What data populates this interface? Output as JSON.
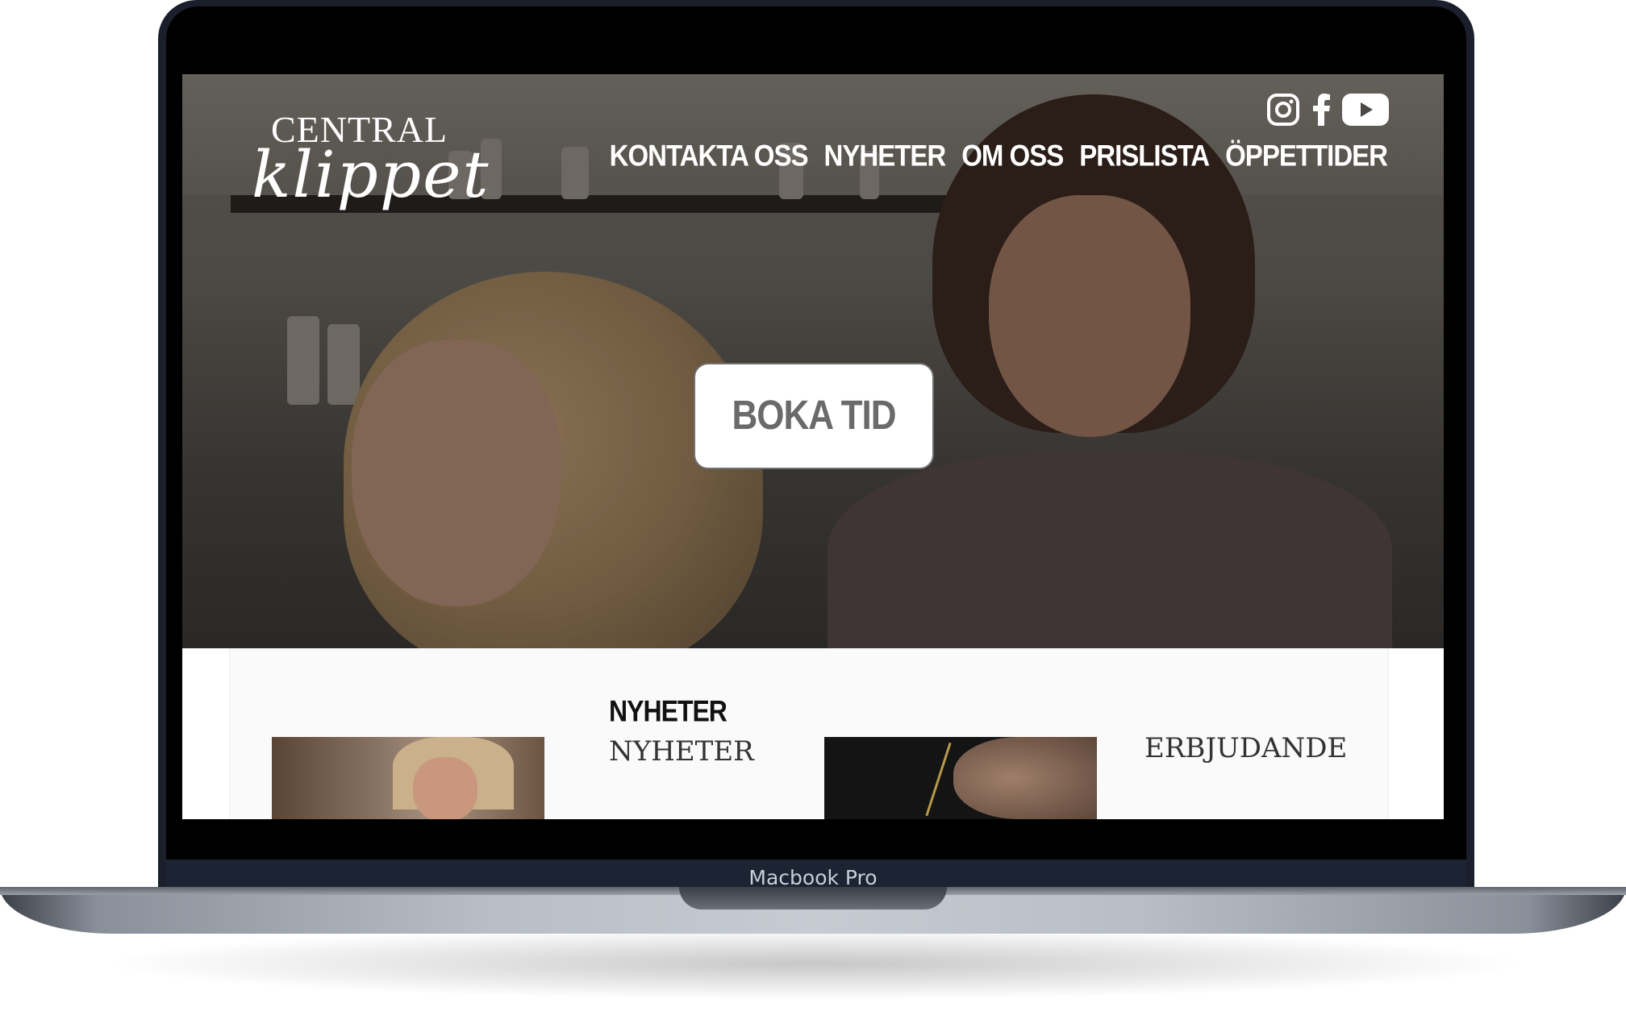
{
  "device": {
    "label": "Macbook Pro"
  },
  "site": {
    "logo": {
      "line1": "CENTRAL",
      "line2": "klippet"
    },
    "social": [
      "instagram-icon",
      "facebook-icon",
      "youtube-icon"
    ],
    "nav": [
      "KONTAKTA OSS",
      "NYHETER",
      "OM OSS",
      "PRISLISTA",
      "ÖPPETTIDER"
    ],
    "hero": {
      "cta": "BOKA TID"
    },
    "sections": {
      "news_kicker": "NYHETER",
      "news_title": "NYHETER",
      "offers_title": "ERBJUDANDE"
    }
  },
  "colors": {
    "frame": "#1a1f2b",
    "cta_text": "#6a6a6a",
    "nav_text": "#ffffff"
  }
}
